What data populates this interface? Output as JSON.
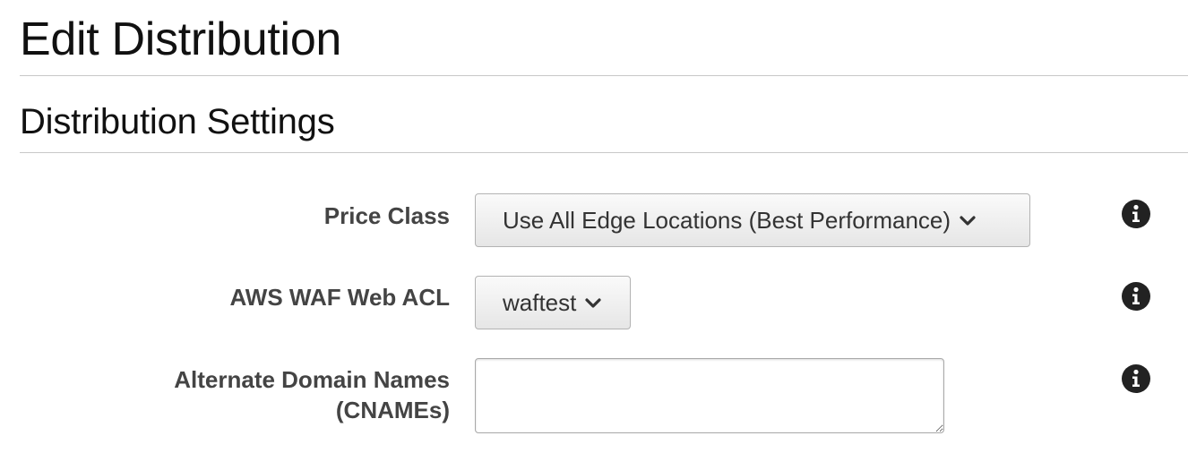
{
  "page": {
    "title": "Edit Distribution",
    "section_title": "Distribution Settings"
  },
  "form": {
    "price_class": {
      "label": "Price Class",
      "selected": "Use All Edge Locations (Best Performance)",
      "info_icon": "info-circle-icon"
    },
    "waf_acl": {
      "label": "AWS WAF Web ACL",
      "selected": "waftest",
      "info_icon": "info-circle-icon"
    },
    "cnames": {
      "label_line1": "Alternate Domain Names",
      "label_line2": "(CNAMEs)",
      "value": "",
      "info_icon": "info-circle-icon"
    }
  },
  "colors": {
    "text": "#111111",
    "label": "#444444",
    "divider": "#c8c8c8",
    "icon": "#222222"
  }
}
